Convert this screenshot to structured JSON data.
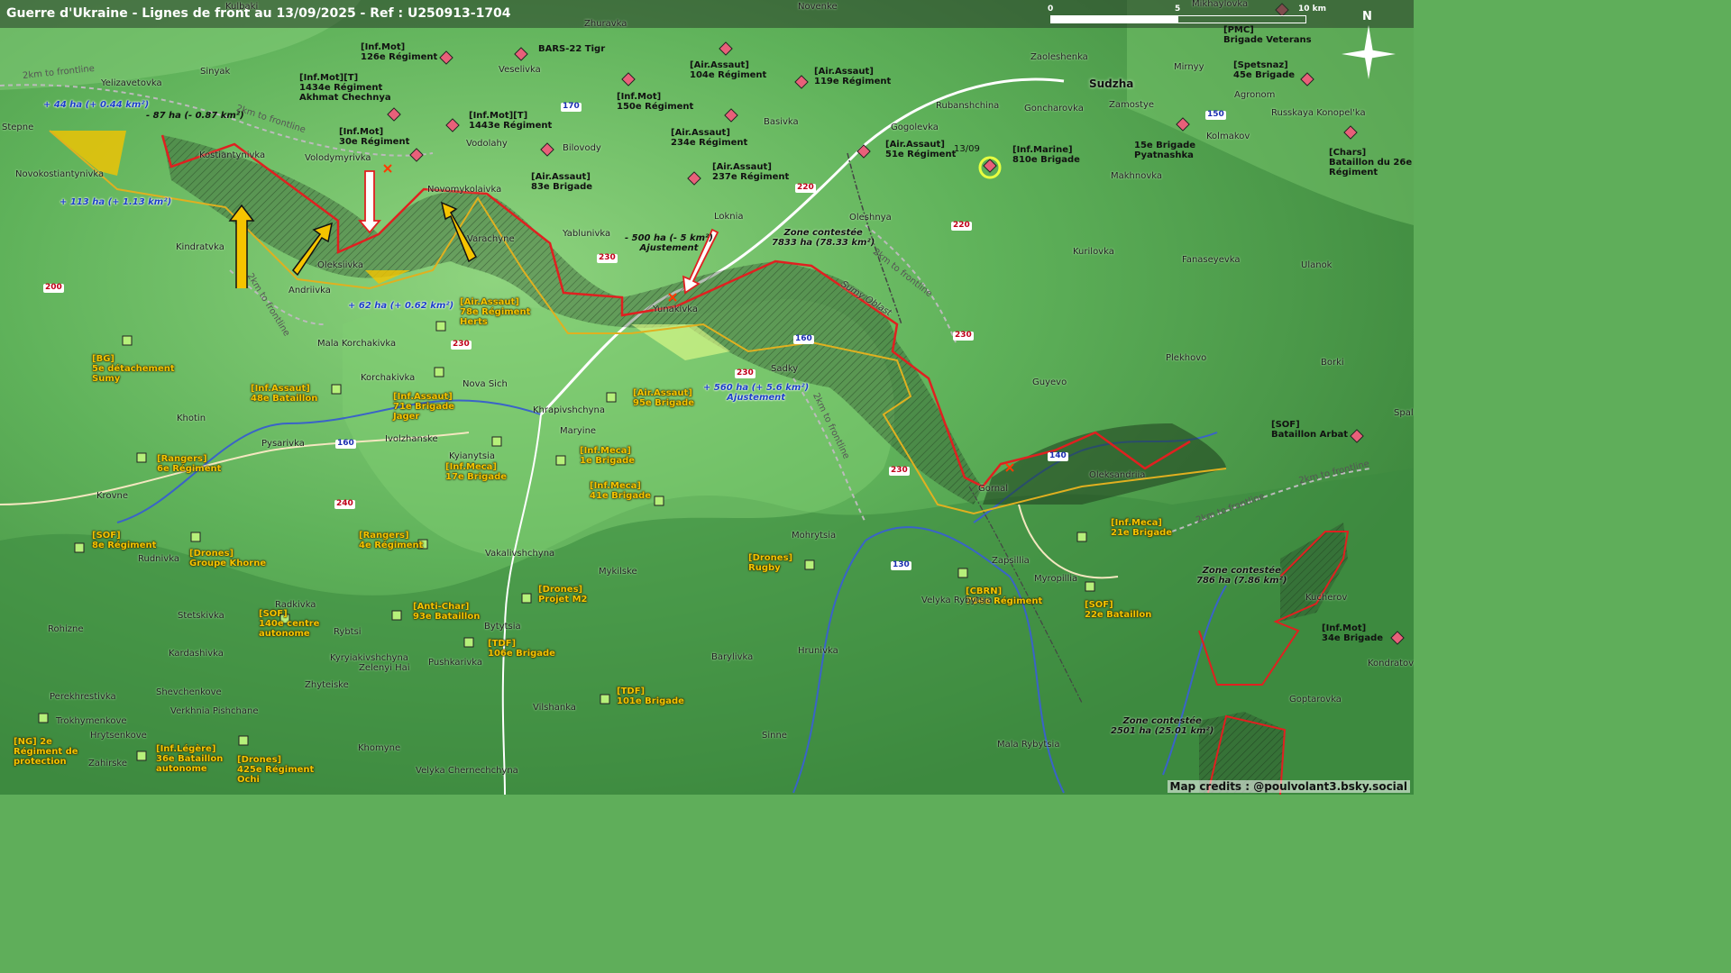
{
  "title": "Guerre d'Ukraine - Lignes de front au 13/09/2025 - Ref : U250913-1704",
  "credits": "Map credits : @poulvolant3.bsky.social",
  "scale": {
    "ticks": [
      "0",
      "5",
      "10 km"
    ]
  },
  "north": "N",
  "colors": {
    "russian_line": "#e02020",
    "ukrainian_line": "#e0b020",
    "contested": "#2c5a2c"
  },
  "units_ru": [
    {
      "id": "ru-126",
      "name": "[Inf.Mot]\n126e Régiment"
    },
    {
      "id": "ru-bars22",
      "name": "BARS-22 Tigr"
    },
    {
      "id": "ru-1434",
      "name": "[Inf.Mot][T]\n1434e Régiment\nAkhmat Chechnya"
    },
    {
      "id": "ru-1443",
      "name": "[Inf.Mot][T]\n1443e Régiment"
    },
    {
      "id": "ru-30",
      "name": "[Inf.Mot]\n30e Régiment"
    },
    {
      "id": "ru-83",
      "name": "[Air.Assaut]\n83e Brigade"
    },
    {
      "id": "ru-104",
      "name": "[Air.Assaut]\n104e Régiment"
    },
    {
      "id": "ru-150",
      "name": "[Inf.Mot]\n150e Régiment"
    },
    {
      "id": "ru-119",
      "name": "[Air.Assaut]\n119e Régiment"
    },
    {
      "id": "ru-234",
      "name": "[Air.Assaut]\n234e Régiment"
    },
    {
      "id": "ru-237",
      "name": "[Air.Assaut]\n237e Régiment"
    },
    {
      "id": "ru-51",
      "name": "[Air.Assaut]\n51e Régiment"
    },
    {
      "id": "ru-810",
      "name": "[Inf.Marine]\n810e Brigade"
    },
    {
      "id": "ru-pmc",
      "name": "[PMC]\nBrigade Veterans"
    },
    {
      "id": "ru-45",
      "name": "[Spetsnaz]\n45e Brigade"
    },
    {
      "id": "ru-15",
      "name": "15e Brigade\nPyatnashka"
    },
    {
      "id": "ru-chars26",
      "name": "[Chars]\nBataillon du 26e\nRégiment"
    },
    {
      "id": "ru-sof-arbat",
      "name": "[SOF]\nBataillon Arbat"
    },
    {
      "id": "ru-34",
      "name": "[Inf.Mot]\n34e Brigade"
    }
  ],
  "units_ua": [
    {
      "id": "ua-78",
      "name": "[Air.Assaut]\n78e Régiment\nHerts"
    },
    {
      "id": "ua-bg5",
      "name": "[BG]\n5e détachement\nSumy"
    },
    {
      "id": "ua-48",
      "name": "[Inf.Assaut]\n48e Bataillon"
    },
    {
      "id": "ua-71",
      "name": "[Inf.Assaut]\n71e Brigade\nJager"
    },
    {
      "id": "ua-95",
      "name": "[Air.Assaut]\n95e Brigade"
    },
    {
      "id": "ua-rang6",
      "name": "[Rangers]\n6e Régiment"
    },
    {
      "id": "ua-17",
      "name": "[Inf.Meca]\n17e Brigade"
    },
    {
      "id": "ua-1",
      "name": "[Inf.Meca]\n1e Brigade"
    },
    {
      "id": "ua-41",
      "name": "[Inf.Meca]\n41e Brigade"
    },
    {
      "id": "ua-sof8",
      "name": "[SOF]\n8e Régiment"
    },
    {
      "id": "ua-khorne",
      "name": "[Drones]\nGroupe Khorne"
    },
    {
      "id": "ua-rang4",
      "name": "[Rangers]\n4e Régiment"
    },
    {
      "id": "ua-m2",
      "name": "[Drones]\nProjet M2"
    },
    {
      "id": "ua-rugby",
      "name": "[Drones]\nRugby"
    },
    {
      "id": "ua-cbrn",
      "name": "[CBRN]\n704e Régiment"
    },
    {
      "id": "ua-21",
      "name": "[Inf.Meca]\n21e Brigade"
    },
    {
      "id": "ua-sof22",
      "name": "[SOF]\n22e Bataillon"
    },
    {
      "id": "ua-antichar",
      "name": "[Anti-Char]\n93e Bataillon"
    },
    {
      "id": "ua-sof140",
      "name": "[SOF]\n140e centre\nautonome"
    },
    {
      "id": "ua-tdf106",
      "name": "[TDF]\n106e Brigade"
    },
    {
      "id": "ua-tdf101",
      "name": "[TDF]\n101e Brigade"
    },
    {
      "id": "ua-ng2",
      "name": "[NG] 2e\nRégiment de\nprotection"
    },
    {
      "id": "ua-leg36",
      "name": "[Inf.Légère]\n36e Bataillon\nautonome"
    },
    {
      "id": "ua-dr425",
      "name": "[Drones]\n425e Régiment\nOchi"
    }
  ],
  "places": [
    "Kulbaki",
    "Zhuravka",
    "Novenke",
    "Mikhaylovka",
    "Sinyak",
    "Yelizavetovka",
    "Veselivka",
    "Zaoleshenka",
    "Mirnyy",
    "Stepne",
    "Novokostiantynivka",
    "Kostiantynivka",
    "Volodymyrivka",
    "Vodolahy",
    "Bilovody",
    "Basivka",
    "Gogolevka",
    "Rubanshchina",
    "Goncharovka",
    "Zamostye",
    "Kolmakov",
    "Agronom",
    "Russkaya Konopel'ka",
    "Makhnovka",
    "Novomykolaivka",
    "Loknia",
    "Oleshnya",
    "Kindratvka",
    "Varachyne",
    "Yablunivka",
    "Oleksiivka",
    "Andriivka",
    "Yunakivka",
    "Kurilovka",
    "Fanaseyevka",
    "Ulanok",
    "Mala Korchakivka",
    "Korchakivka",
    "Nova Sich",
    "Sadky",
    "Plekhovo",
    "Borki",
    "Guyevo",
    "Khotin",
    "Khrapivshchyna",
    "Maryine",
    "Pysarivka",
    "Ivolzhanske",
    "Kyianytsia",
    "Krovne",
    "Oleksandriia",
    "Gornal",
    "Spal",
    "Rudnivka",
    "Vakalivshchyna",
    "Mykilske",
    "Mohrytsia",
    "Zapsillia",
    "Myropillia",
    "Kucherov",
    "Radkivka",
    "Stetskivka",
    "Rohizne",
    "Kardashivka",
    "Rybtsi",
    "Bytytsia",
    "Pushkarivka",
    "Kyryiakivshchyna",
    "Zelenyi Hai",
    "Zhyteiske",
    "Velyka Rybytsia",
    "Hrunivka",
    "Barylivka",
    "Kondratov",
    "Goptarovka",
    "Shevchenkove",
    "Perekhrestivka",
    "Trokhymenkove",
    "Verkhnia Pishchane",
    "Hrytsenkove",
    "Zahirske",
    "Vilshanka",
    "Sinne",
    "Khomyne",
    "Velyka Chernechchyna",
    "Mala Rybytsia"
  ],
  "place_big": "Sudzha",
  "roads": [
    "170",
    "220",
    "220",
    "230",
    "230",
    "230",
    "230",
    "200",
    "160",
    "160",
    "240",
    "130",
    "150",
    "140",
    "230"
  ],
  "region": "Sumy Oblast",
  "frontline": "2km to frontline",
  "date_marker": "13/09",
  "annotations": {
    "a1": "+ 44 ha (+ 0.44 km²)",
    "a2": "- 87 ha (- 0.87 km²)",
    "a3": "+ 113 ha (+ 1.13 km²)",
    "a4": "+ 62 ha (+ 0.62 km²)",
    "a5": "- 500 ha (- 5 km²)",
    "a5b": "Ajustement",
    "a6": "+ 560 ha (+ 5.6 km²)",
    "a6b": "Ajustement"
  },
  "zones": {
    "z1": "Zone contestée\n7833 ha (78.33 km²)",
    "z2": "Zone contestée\n786 ha (7.86 km²)",
    "z3": "Zone contestée\n2501 ha (25.01 km²)"
  }
}
